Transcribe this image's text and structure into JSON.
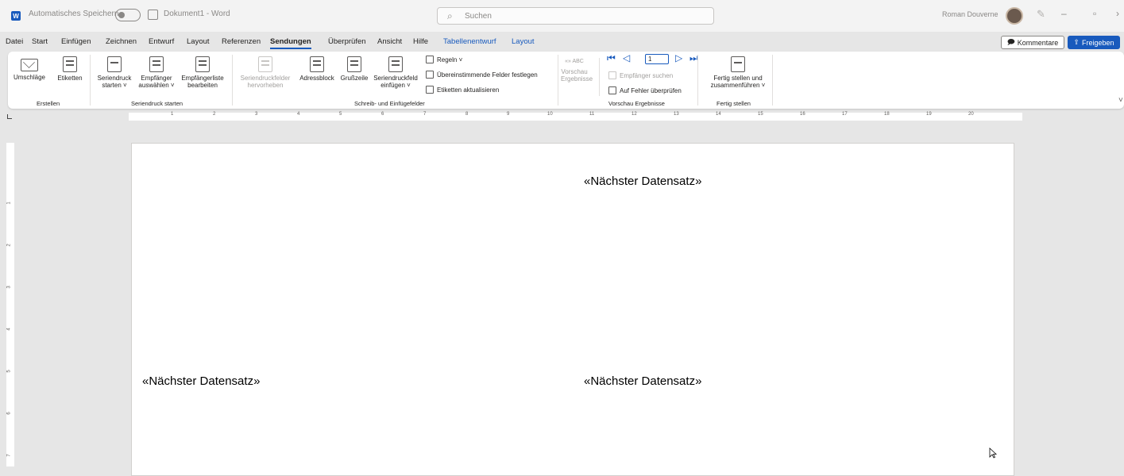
{
  "titlebar": {
    "app_badge": "W",
    "autosave_label": "Automatisches Speichern",
    "doc_title": "Dokument1 - Word",
    "search_placeholder": "Suchen",
    "user_name": "Roman Douverne"
  },
  "menu": {
    "items": [
      "Datei",
      "Start",
      "Einfügen",
      "Zeichnen",
      "Entwurf",
      "Layout",
      "Referenzen",
      "Sendungen",
      "Überprüfen",
      "Ansicht",
      "Hilfe",
      "Tabellenentwurf",
      "Layout"
    ],
    "active": "Sendungen",
    "comments_button": "Kommentare",
    "share_button": "Freigeben"
  },
  "ribbon": {
    "erstellen": {
      "group_label": "Erstellen",
      "umschlaege": "Umschläge",
      "etiketten": "Etiketten"
    },
    "seriendruck_starten": {
      "group_label": "Seriendruck starten",
      "seriendruck_l1": "Seriendruck",
      "seriendruck_l2": "starten ˅",
      "empfaenger_l1": "Empfänger",
      "empfaenger_l2": "auswählen ˅",
      "liste_l1": "Empfängerliste",
      "liste_l2": "bearbeiten"
    },
    "schreib": {
      "group_label": "Schreib- und Einfügefelder",
      "hervorheben_l1": "Seriendruckfelder",
      "hervorheben_l2": "hervorheben",
      "adressblock": "Adressblock",
      "grusszeile": "Grußzeile",
      "feld_l1": "Seriendruckfeld",
      "feld_l2": "einfügen ˅",
      "regeln": "Regeln ˅",
      "uebereinstimmende": "Übereinstimmende Felder festlegen",
      "etiketten_aktualisieren": "Etiketten aktualisieren"
    },
    "vorschau": {
      "group_label": "Vorschau Ergebnisse",
      "abc": "«» ABC",
      "vorschau_l1": "Vorschau",
      "vorschau_l2": "Ergebnisse",
      "record": "1",
      "empfaenger_suchen": "Empfänger suchen",
      "fehler": "Auf Fehler überprüfen"
    },
    "fertig": {
      "group_label": "Fertig stellen",
      "fertig_l1": "Fertig stellen und",
      "fertig_l2": "zusammenführen ˅"
    }
  },
  "ruler": {
    "numbers": [
      "1",
      "2",
      "3",
      "4",
      "5",
      "6",
      "7",
      "8",
      "9",
      "10",
      "11",
      "12",
      "13",
      "14",
      "15",
      "16",
      "17",
      "18",
      "19",
      "20"
    ],
    "vnumbers": [
      "1",
      "2",
      "3",
      "4",
      "5",
      "6",
      "7"
    ]
  },
  "document": {
    "field_1": "«Nächster Datensatz»",
    "field_2": "«Nächster Datensatz»",
    "field_3": "«Nächster Datensatz»"
  }
}
